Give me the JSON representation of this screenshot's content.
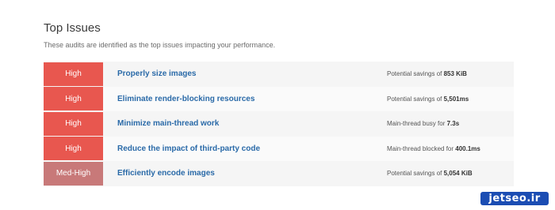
{
  "header": {
    "title": "Top Issues",
    "subtitle": "These audits are identified as the top issues impacting your performance."
  },
  "issues": [
    {
      "severity": "High",
      "name": "Properly size images",
      "savings_prefix": "Potential savings of ",
      "savings_value": "853 KiB"
    },
    {
      "severity": "High",
      "name": "Eliminate render-blocking resources",
      "savings_prefix": "Potential savings of ",
      "savings_value": "5,501ms"
    },
    {
      "severity": "High",
      "name": "Minimize main-thread work",
      "savings_prefix": "Main-thread busy for ",
      "savings_value": "7.3s"
    },
    {
      "severity": "High",
      "name": "Reduce the impact of third-party code",
      "savings_prefix": "Main-thread blocked for ",
      "savings_value": "400.1ms"
    },
    {
      "severity": "Med-High",
      "name": "Efficiently encode images",
      "savings_prefix": "Potential savings of ",
      "savings_value": "5,054 KiB"
    }
  ],
  "colors": {
    "high": "#e8574f",
    "med_high": "#c87979",
    "link": "#2a6aa8"
  },
  "watermark": {
    "text": "jetseo.ir"
  }
}
